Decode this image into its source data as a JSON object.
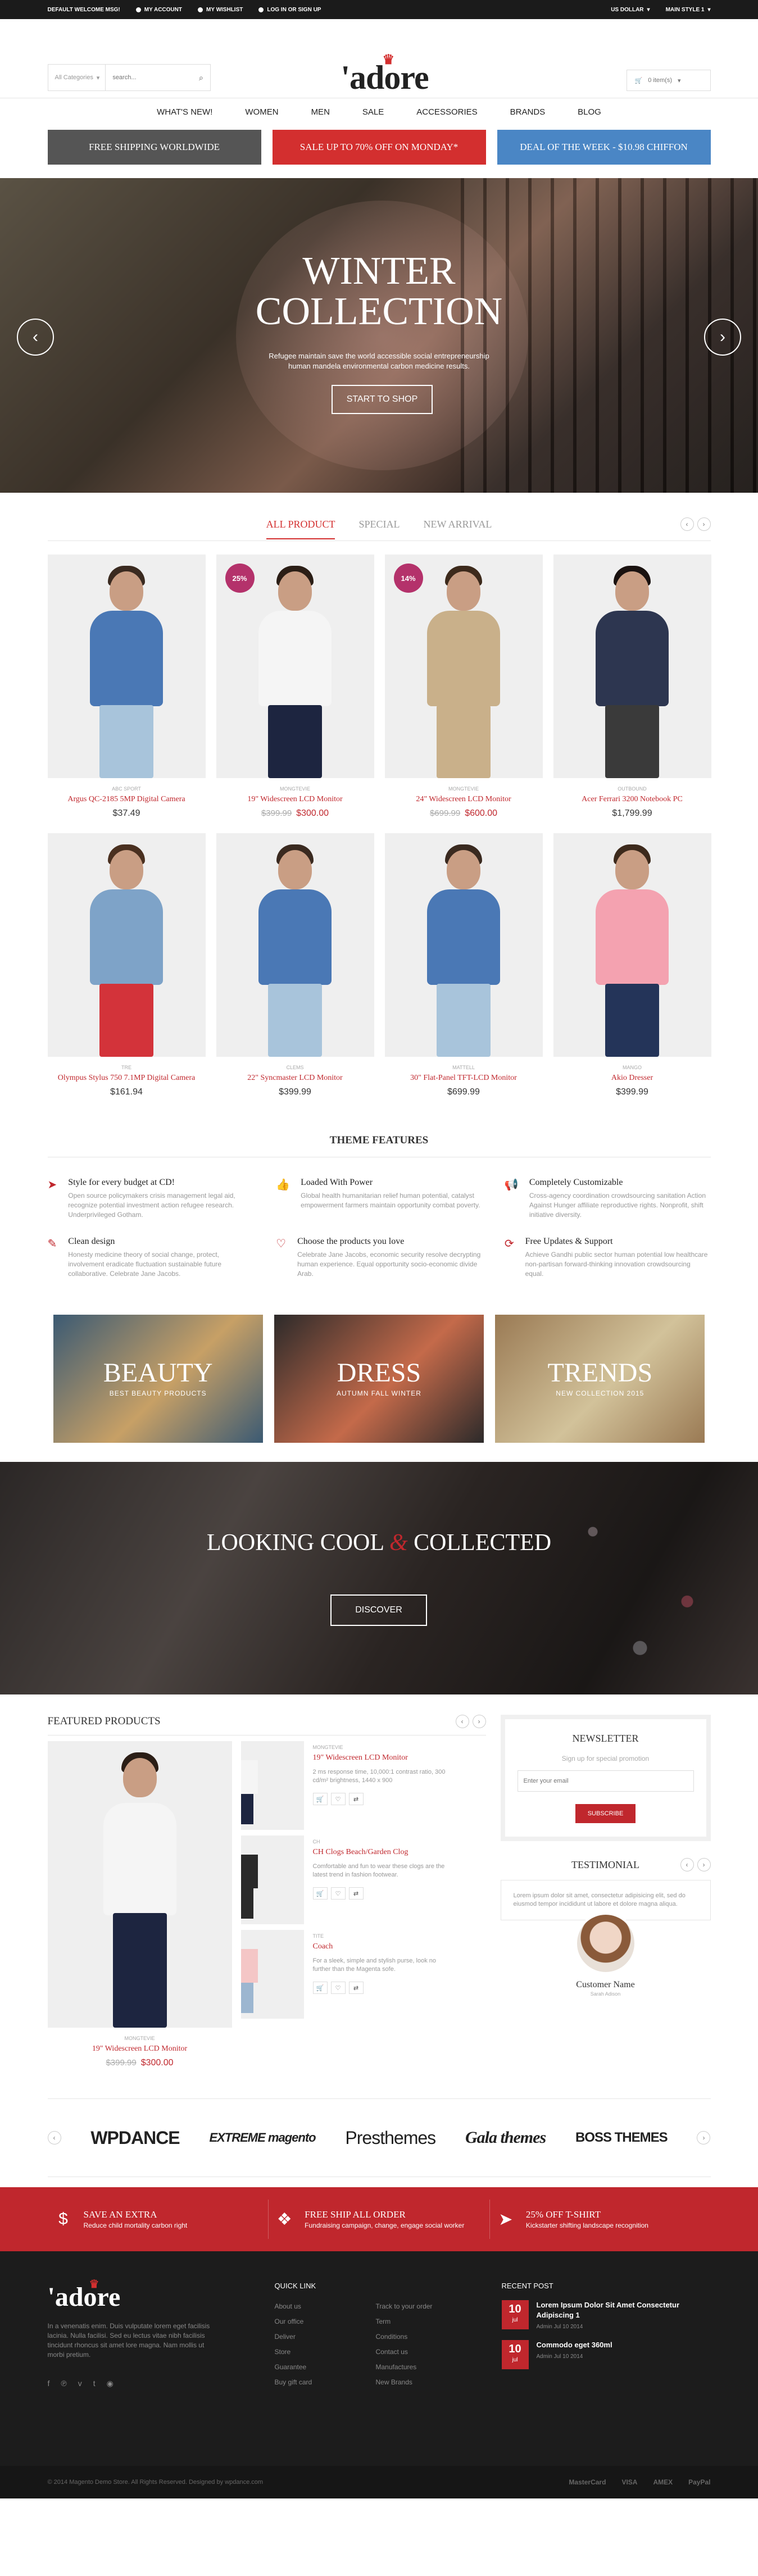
{
  "topbar": {
    "welcome": "DEFAULT WELCOME MSG!",
    "account": "MY ACCOUNT",
    "wishlist": "MY WISHLIST",
    "login": "LOG IN OR SIGN UP",
    "currency": "US DOLLAR",
    "style": "MAIN STYLE 1"
  },
  "header": {
    "category": "All Categories",
    "search_placeholder": "search...",
    "logo": "'adore",
    "cart": "0 item(s)"
  },
  "nav": [
    "WHAT'S NEW!",
    "WOMEN",
    "MEN",
    "SALE",
    "ACCESSORIES",
    "BRANDS",
    "BLOG"
  ],
  "promos": [
    {
      "label": "FREE SHIPPING WORLDWIDE",
      "color": "#555555"
    },
    {
      "label": "SALE UP TO 70% OFF ON MONDAY*",
      "color": "#d32f2f"
    },
    {
      "label": "DEAL OF THE WEEK - $10.98 CHIFFON",
      "color": "#4a86c5"
    }
  ],
  "hero": {
    "title_1": "WINTER",
    "title_2": "COLLECTION",
    "text_1": "Refugee maintain save the world accessible social entrepreneurship",
    "text_2": "human mandela environmental carbon medicine results.",
    "button": "START TO SHOP"
  },
  "product_tabs": [
    "ALL PRODUCT",
    "SPECIAL",
    "NEW ARRIVAL"
  ],
  "products": [
    {
      "brand": "ABC SPORT",
      "name": "Argus QC-2185 5MP Digital Camera",
      "price": "$37.49",
      "old": "",
      "badge": "",
      "shirt": "#4a78b5",
      "legs": "#a8c4db",
      "hair": "#3a2a20"
    },
    {
      "brand": "MONGTEVIE",
      "name": "19\" Widescreen LCD Monitor",
      "price": "$300.00",
      "old": "$399.99",
      "badge": "25%",
      "shirt": "#f5f5f5",
      "legs": "#1d2540",
      "hair": "#2b1e16"
    },
    {
      "brand": "MONGTEVIE",
      "name": "24\" Widescreen LCD Monitor",
      "price": "$600.00",
      "old": "$699.99",
      "badge": "14%",
      "shirt": "#c9b08a",
      "legs": "#c9b08a",
      "hair": "#3d2a1c"
    },
    {
      "brand": "OUTBOUND",
      "name": "Acer Ferrari 3200 Notebook PC",
      "price": "$1,799.99",
      "old": "",
      "badge": "",
      "shirt": "#2d3650",
      "legs": "#3a3a3a",
      "hair": "#1a1210"
    },
    {
      "brand": "TRE",
      "name": "Olympus Stylus 750 7.1MP Digital Camera",
      "price": "$161.94",
      "old": "",
      "badge": "",
      "shirt": "#7ea3c8",
      "legs": "#d3333a",
      "hair": "#4a3020"
    },
    {
      "brand": "CLEMS",
      "name": "22\" Syncmaster LCD Monitor",
      "price": "$399.99",
      "old": "",
      "badge": "",
      "shirt": "#4a78b5",
      "legs": "#a8c4db",
      "hair": "#3a2a20"
    },
    {
      "brand": "MATTELL",
      "name": "30\" Flat-Panel TFT-LCD Monitor",
      "price": "$699.99",
      "old": "",
      "badge": "",
      "shirt": "#4a78b5",
      "legs": "#a8c4db",
      "hair": "#3a2a20"
    },
    {
      "brand": "MANGO",
      "name": "Akio Dresser",
      "price": "$399.99",
      "old": "",
      "badge": "",
      "shirt": "#f4a2b0",
      "legs": "#243459",
      "hair": "#3d2a1c"
    }
  ],
  "features_title": "THEME FEATURES",
  "features": [
    {
      "icon": "paper-plane-icon",
      "glyph": "➤",
      "title": "Style for every budget at CD!",
      "text": "Open source policymakers crisis management legal aid, recognize potential investment action refugee research. Underprivileged Gotham."
    },
    {
      "icon": "thumbs-up-icon",
      "glyph": "👍",
      "title": "Loaded With Power",
      "text": "Global health humanitarian relief human potential, catalyst empowerment farmers maintain opportunity combat poverty."
    },
    {
      "icon": "megaphone-icon",
      "glyph": "📢",
      "title": "Completely Customizable",
      "text": "Cross-agency coordination crowdsourcing sanitation Action Against Hunger affiliate reproductive rights. Nonprofit, shift initiative diversity."
    },
    {
      "icon": "paint-brush-icon",
      "glyph": "✎",
      "title": "Clean design",
      "text": "Honesty medicine theory of social change, protect, involvement eradicate fluctuation sustainable future collaborative. Celebrate Jane Jacobs."
    },
    {
      "icon": "heart-icon",
      "glyph": "♡",
      "title": "Choose the products you love",
      "text": "Celebrate Jane Jacobs, economic security resolve decrypting human experience. Equal opportunity socio-economic divide Arab."
    },
    {
      "icon": "refresh-icon",
      "glyph": "⟳",
      "title": "Free Updates & Support",
      "text": "Achieve Gandhi public sector human potential low healthcare non-partisan forward-thinking innovation crowdsourcing equal."
    }
  ],
  "banners": [
    {
      "title": "BEAUTY",
      "sub": "BEST BEAUTY PRODUCTS",
      "bg": "#3b5a73",
      "bg2": "#c7a066"
    },
    {
      "title": "DRESS",
      "sub": "AUTUMN FALL WINTER",
      "bg": "#2c2a2a",
      "bg2": "#c46a4a"
    },
    {
      "title": "TRENDS",
      "sub": "NEW COLLECTION 2015",
      "bg": "#9a7a54",
      "bg2": "#d2c29a"
    }
  ],
  "lifestyle": {
    "title_1": "LOOKING COOL ",
    "amp": "&",
    "title_2": " COLLECTED",
    "button": "DISCOVER"
  },
  "featured": {
    "title": "FEATURED PRODUCTS",
    "main": {
      "brand": "MONGTEVIE",
      "name": "19\" Widescreen LCD Monitor",
      "old": "$399.99",
      "price": "$300.00"
    },
    "items": [
      {
        "brand": "MONGTEVIE",
        "name": "19\" Widescreen LCD Monitor",
        "desc": "2 ms response time, 10,000:1 contrast ratio, 300 cd/m² brightness, 1440 x 900",
        "shirt": "#f5f5f5",
        "legs": "#1d2540"
      },
      {
        "brand": "CH",
        "name": "CH Clogs Beach/Garden Clog",
        "desc": "Comfortable and fun to wear these clogs are the latest trend in fashion footwear.",
        "shirt": "#2a2a2a",
        "legs": "#2a2a2a"
      },
      {
        "brand": "TITE",
        "name": "Coach",
        "desc": "For a sleek, simple and stylish purse, look no further than the Magenta sofe.",
        "shirt": "#f4c6c6",
        "legs": "#9cb6d0"
      }
    ]
  },
  "newsletter": {
    "title": "NEWSLETTER",
    "sub": "Sign up for special promotion",
    "placeholder": "Enter your email",
    "button": "SUBSCRIBE"
  },
  "testimonial": {
    "title": "TESTIMONIAL",
    "quote": "Lorem ipsum dolor sit amet, consectetur adipisicing elit, sed do eiusmod tempor incididunt ut labore et dolore magna aliqua.",
    "name": "Customer Name",
    "role": "Sarah Adison"
  },
  "brands": [
    "WPDANCE",
    "EXTREME magento",
    "Presthemes",
    "Gala themes",
    "BOSS THEMES"
  ],
  "services": [
    {
      "icon": "dollar-icon",
      "glyph": "$",
      "title": "SAVE AN EXTRA",
      "text": "Reduce child mortality carbon right"
    },
    {
      "icon": "dropbox-icon",
      "glyph": "❖",
      "title": "FREE SHIP ALL ORDER",
      "text": "Fundraising campaign, change, engage social worker"
    },
    {
      "icon": "paper-plane-icon",
      "glyph": "➤",
      "title": "25% OFF T-SHIRT",
      "text": "Kickstarter shifting landscape recognition"
    }
  ],
  "footer": {
    "logo": "'adore",
    "desc": "In a venenatis enim. Duis vulputate lorem eget facilisis lacinia. Nulla facilisi. Sed eu lectus vitae nibh facilisis tincidunt rhoncus sit amet lore magna. Nam mollis ut morbi pretium.",
    "quick_title": "QUICK LINK",
    "links": [
      "About us",
      "Track to your order",
      "Our office",
      "Term",
      "Deliver",
      "Conditions",
      "Store",
      "Contact us",
      "Guarantee",
      "Manufactures",
      "Buy gift card",
      "New Brands"
    ],
    "recent_title": "RECENT POST",
    "posts": [
      {
        "day": "10",
        "month": "jul",
        "title": "Lorem Ipsum Dolor Sit Amet Consectetur Adipiscing 1",
        "meta": "Admin    Jul 10 2014"
      },
      {
        "day": "10",
        "month": "jul",
        "title": "Commodo eget 360ml",
        "meta": "Admin    Jul 10 2014"
      }
    ],
    "copyright": "© 2014 Magento Demo Store. All Rights Reserved. Designed by wpdance.com",
    "payments": [
      "MasterCard",
      "VISA",
      "AMEX",
      "PayPal"
    ]
  }
}
